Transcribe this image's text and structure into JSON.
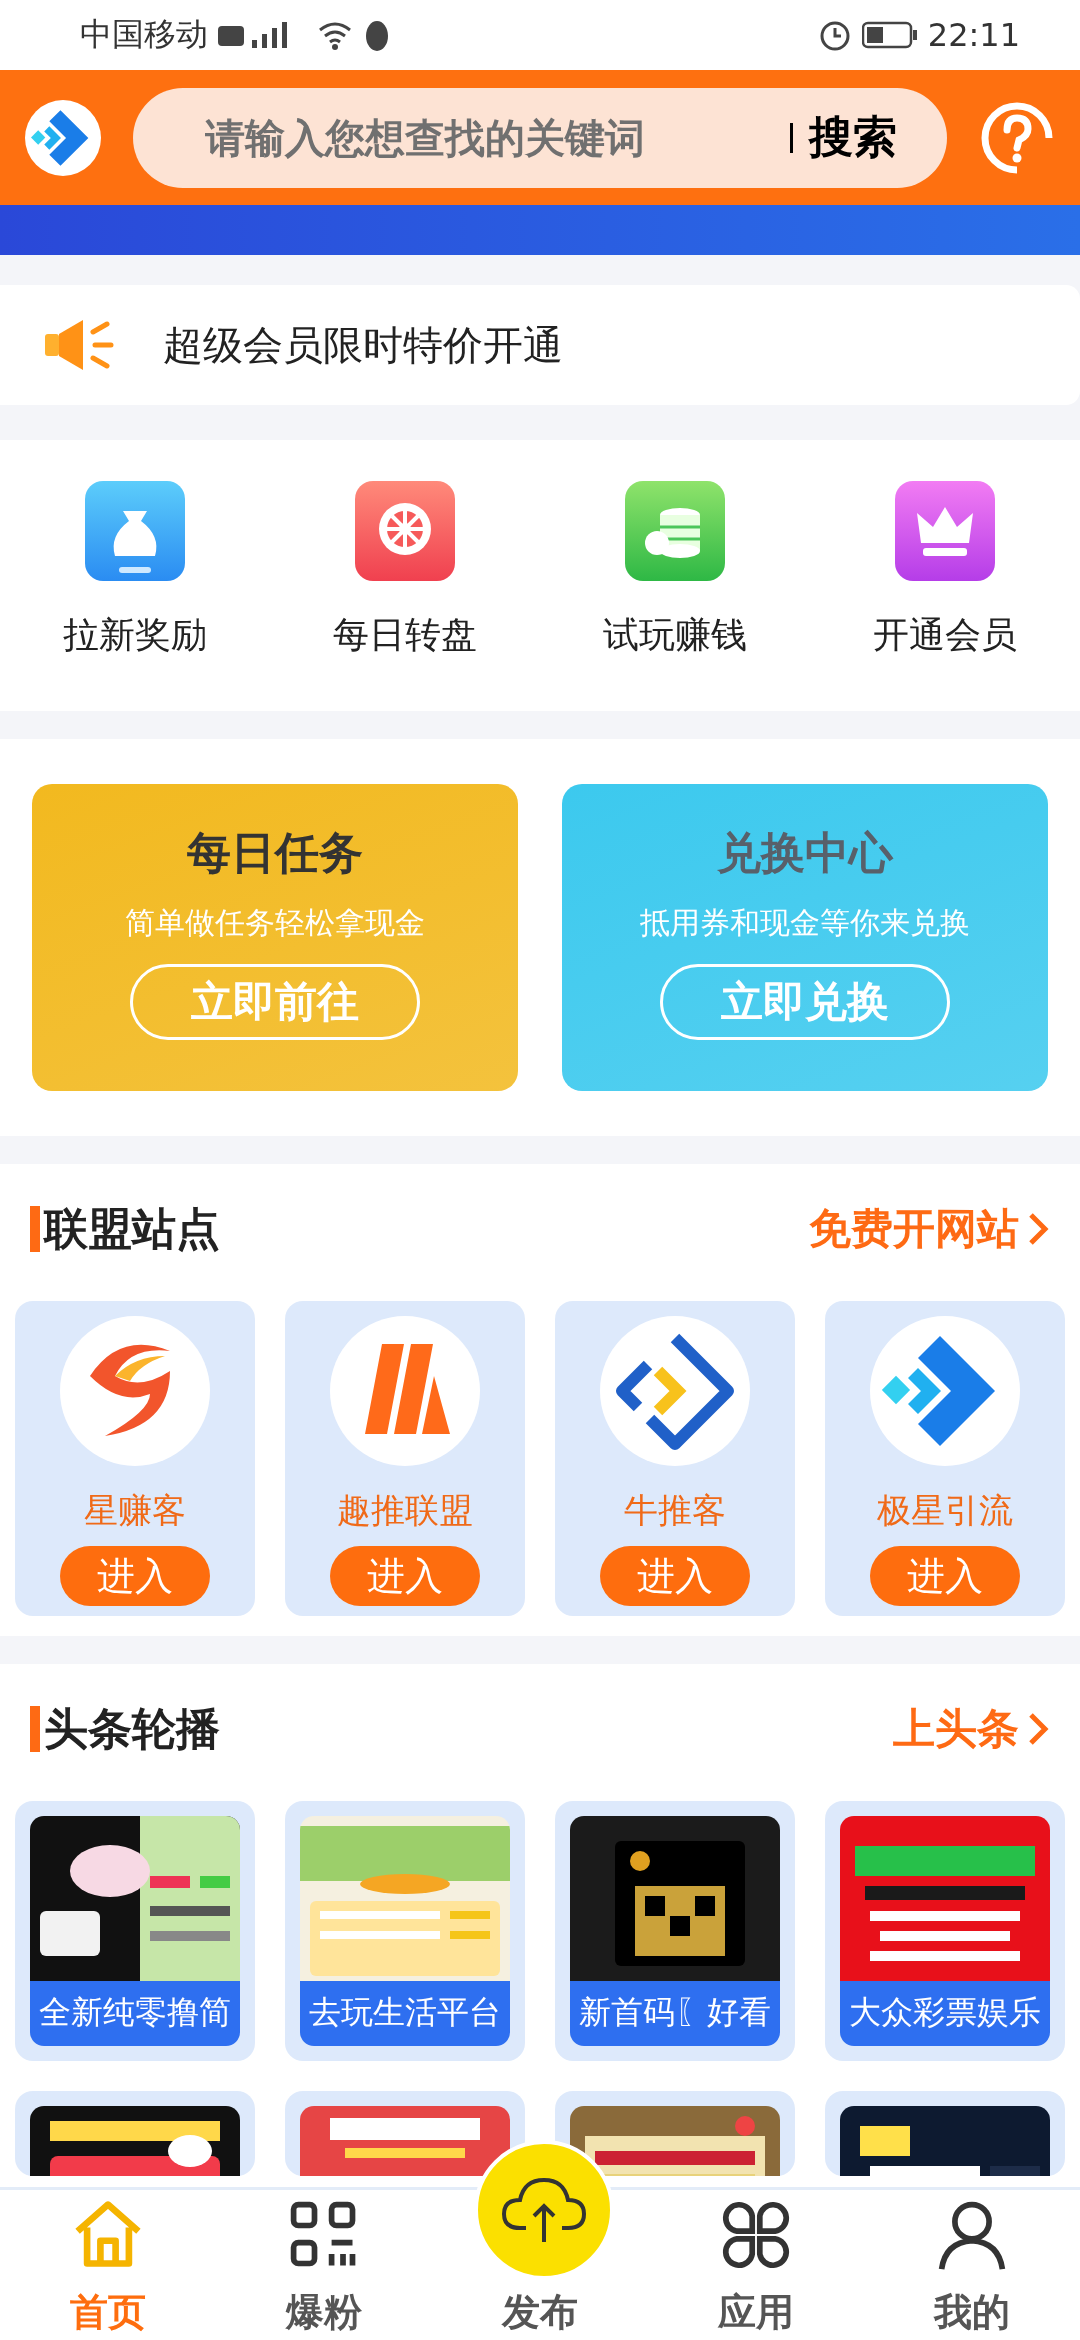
{
  "status_bar": {
    "carrier": "中国移动",
    "time": "22:11"
  },
  "header": {
    "search": {
      "placeholder": "请输入您想查找的关键词",
      "button": "搜索"
    }
  },
  "notice": {
    "text": "超级会员限时特价开通"
  },
  "quick_links": [
    {
      "label": "拉新奖励"
    },
    {
      "label": "每日转盘"
    },
    {
      "label": "试玩赚钱"
    },
    {
      "label": "开通会员"
    }
  ],
  "promo_cards": [
    {
      "title": "每日任务",
      "subtitle": "简单做任务轻松拿现金",
      "button": "立即前往",
      "color": "#f2b91f"
    },
    {
      "title": "兑换中心",
      "subtitle": "抵用券和现金等你来兑换",
      "button": "立即兑换",
      "color": "#3cc9ee"
    }
  ],
  "alliance": {
    "title": "联盟站点",
    "link": "免费开网站",
    "sites": [
      {
        "name": "星赚客",
        "button": "进入"
      },
      {
        "name": "趣推联盟",
        "button": "进入"
      },
      {
        "name": "牛推客",
        "button": "进入"
      },
      {
        "name": "极星引流",
        "button": "进入"
      }
    ]
  },
  "headlines": {
    "title": "头条轮播",
    "link": "上头条",
    "items": [
      {
        "caption": "全新纯零撸简"
      },
      {
        "caption": "去玩生活平台"
      },
      {
        "caption": "新首码〖好看"
      },
      {
        "caption": "大众彩票娱乐"
      },
      {
        "kind": "picture"
      },
      {
        "kind": "picture"
      },
      {
        "kind": "picture"
      },
      {
        "kind": "picture"
      }
    ]
  },
  "bottom_nav": [
    {
      "label": "首页",
      "selected": true
    },
    {
      "label": "爆粉",
      "selected": false
    },
    {
      "label": "发布",
      "selected": false
    },
    {
      "label": "应用",
      "selected": false
    },
    {
      "label": "我的",
      "selected": false
    }
  ]
}
